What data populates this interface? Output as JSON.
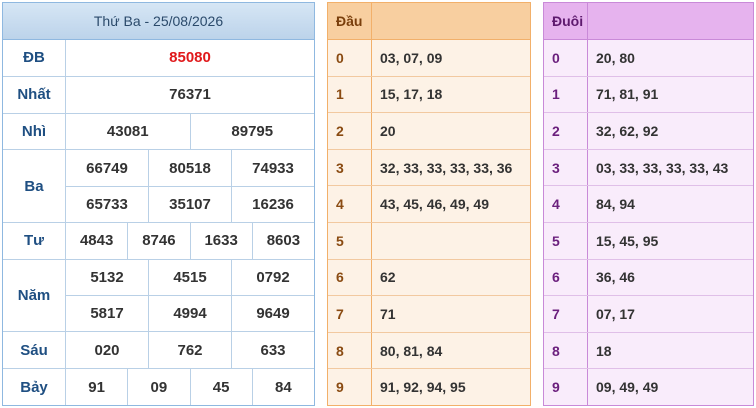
{
  "results": {
    "header": "Thứ Ba - 25/08/2026",
    "prizes": [
      {
        "label": "ĐB",
        "lines": [
          [
            "85080"
          ]
        ]
      },
      {
        "label": "Nhất",
        "lines": [
          [
            "76371"
          ]
        ]
      },
      {
        "label": "Nhì",
        "lines": [
          [
            "43081",
            "89795"
          ]
        ]
      },
      {
        "label": "Ba",
        "lines": [
          [
            "66749",
            "80518",
            "74933"
          ],
          [
            "65733",
            "35107",
            "16236"
          ]
        ]
      },
      {
        "label": "Tư",
        "lines": [
          [
            "4843",
            "8746",
            "1633",
            "8603"
          ]
        ]
      },
      {
        "label": "Năm",
        "lines": [
          [
            "5132",
            "4515",
            "0792"
          ],
          [
            "5817",
            "4994",
            "9649"
          ]
        ]
      },
      {
        "label": "Sáu",
        "lines": [
          [
            "020",
            "762",
            "633"
          ]
        ]
      },
      {
        "label": "Bảy",
        "lines": [
          [
            "91",
            "09",
            "45",
            "84"
          ]
        ]
      }
    ]
  },
  "dau": {
    "title": "Đầu",
    "rows": [
      {
        "key": "0",
        "value": "03, 07, 09"
      },
      {
        "key": "1",
        "value": "15, 17, 18"
      },
      {
        "key": "2",
        "value": "20"
      },
      {
        "key": "3",
        "value": "32, 33, 33, 33, 33, 36"
      },
      {
        "key": "4",
        "value": "43, 45, 46, 49, 49"
      },
      {
        "key": "5",
        "value": ""
      },
      {
        "key": "6",
        "value": "62"
      },
      {
        "key": "7",
        "value": "71"
      },
      {
        "key": "8",
        "value": "80, 81, 84"
      },
      {
        "key": "9",
        "value": "91, 92, 94, 95"
      }
    ]
  },
  "duoi": {
    "title": "Đuôi",
    "rows": [
      {
        "key": "0",
        "value": "20, 80"
      },
      {
        "key": "1",
        "value": "71, 81, 91"
      },
      {
        "key": "2",
        "value": "32, 62, 92"
      },
      {
        "key": "3",
        "value": "03, 33, 33, 33, 33, 43"
      },
      {
        "key": "4",
        "value": "84, 94"
      },
      {
        "key": "5",
        "value": "15, 45, 95"
      },
      {
        "key": "6",
        "value": "36, 46"
      },
      {
        "key": "7",
        "value": "07, 17"
      },
      {
        "key": "8",
        "value": "18"
      },
      {
        "key": "9",
        "value": "09, 49, 49"
      }
    ]
  },
  "colors": {
    "special_prize": "#e0191b",
    "results_border": "#8fb8e0",
    "dau_accent": "#f8cfa0",
    "duoi_accent": "#e6b3ee"
  }
}
